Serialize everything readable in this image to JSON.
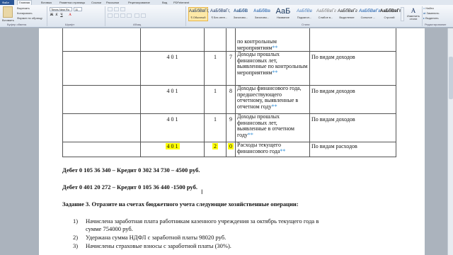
{
  "tabs": [
    "Файл",
    "Главная",
    "Вставка",
    "Разметка страницы",
    "Ссылки",
    "Рассылки",
    "Рецензирование",
    "Вид",
    "PDFelement"
  ],
  "clipboard": {
    "paste": "Вставить",
    "cut": "Вырезать",
    "copy": "Копировать",
    "format": "Формат по образцу",
    "label": "Буфер обмена"
  },
  "font": {
    "name": "Times New Ro",
    "size": "11",
    "label": "Шрифт"
  },
  "paragraph": {
    "label": "Абзац"
  },
  "styles": {
    "label": "Стили",
    "items": [
      {
        "sample": "АаБбВвГг,",
        "name": "¶ Обычный"
      },
      {
        "sample": "АаБбВвГг,",
        "name": "¶ Без инте..."
      },
      {
        "sample": "АаБбВ",
        "name": "Заголово..."
      },
      {
        "sample": "АаБбВв",
        "name": "Заголово..."
      },
      {
        "sample": "АаБ",
        "name": "Название"
      },
      {
        "sample": "АаБбВв",
        "name": "Подзагол..."
      },
      {
        "sample": "АаБбВвГг",
        "name": "Слабое в..."
      },
      {
        "sample": "АаБбВвГг",
        "name": "Выделение"
      },
      {
        "sample": "АаБбВвГг",
        "name": "Сильное ..."
      },
      {
        "sample": "АаБбВвГг",
        "name": "Строгий"
      }
    ],
    "change": "Изменить стили"
  },
  "editing": {
    "find": "Найти",
    "replace": "Заменить",
    "select": "Выделить",
    "label": "Редактирование"
  },
  "table": {
    "rows": [
      {
        "code": "",
        "n1": "",
        "n2": "",
        "desc": "по контрольным мероприятиям",
        "stars": "**",
        "note": ""
      },
      {
        "code": "4 0 1",
        "n1": "1",
        "n2": "7",
        "desc": "Доходы прошлых финансовых лет, выявленные по контрольным мероприятиям",
        "stars": "**",
        "note": "По видам доходов"
      },
      {
        "code": "4 0 1",
        "n1": "1",
        "n2": "8",
        "desc": "Доходы финансового года, предшествующего отчетному, выявленные в отчетном году",
        "stars": "**",
        "note": "По видам доходов"
      },
      {
        "code": "4 0 1",
        "n1": "1",
        "n2": "9",
        "desc": "Доходы прошлых финансовых лет, выявленные в отчетном году",
        "stars": "**",
        "note": "По видам доходов"
      },
      {
        "code": "4 0 1",
        "n1": "2",
        "n2": "0",
        "desc": "Расходы текущего финансового года",
        "stars": "**",
        "note": "По видам расходов"
      }
    ]
  },
  "body": {
    "line1": "Дебет  0 105 36 340 – Кредит 0 302 34 730 – 4500 руб.",
    "line2": "Дебет 0 401 20 272 – Кредит 0 105 36 440 -1500 руб.",
    "task": "Задание 3. Отразите на счетах бюджетного учета следующие хозяйственные операции:",
    "items": [
      {
        "num": "1)",
        "text": "Начислена заработная плата работникам казенного учреждения за октябрь текущего года в",
        "cont": "сумме 754000 руб."
      },
      {
        "num": "2)",
        "text": "Удержана сумма НДФЛ с заработной платы 98020 руб."
      },
      {
        "num": "3)",
        "text": "Начислены страховые взносы с заработной платы (30%)."
      }
    ]
  }
}
